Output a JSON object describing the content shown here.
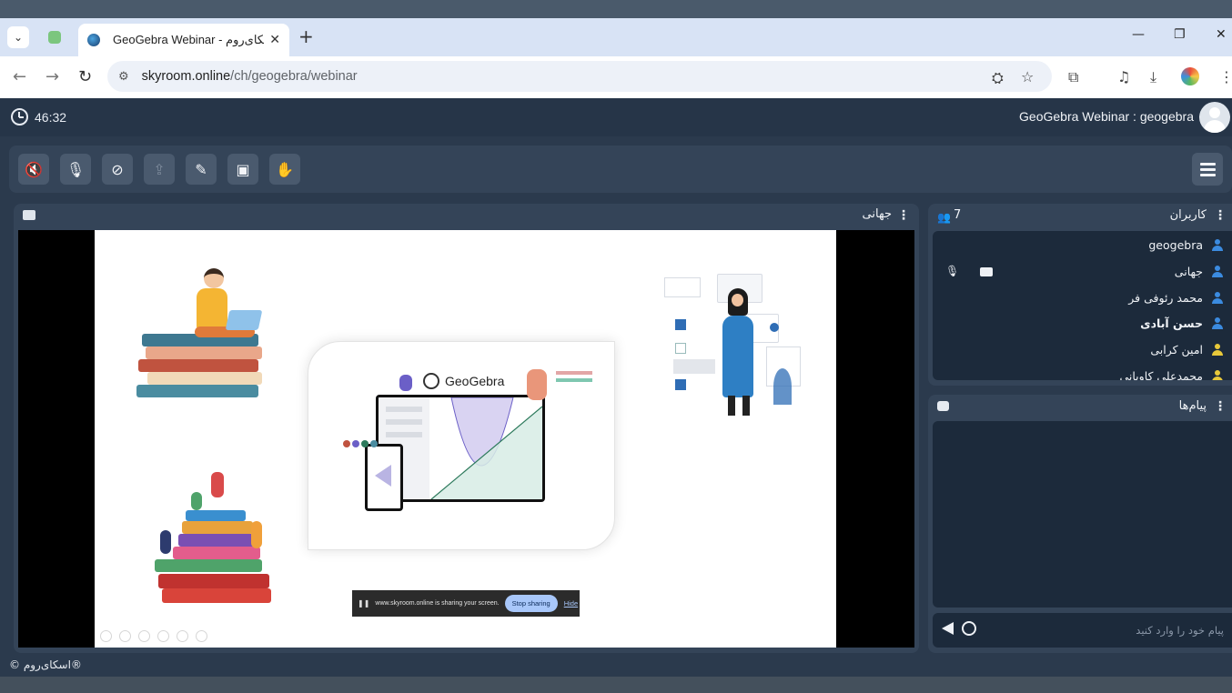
{
  "browser": {
    "tab_title": "GeoGebra Webinar - اسکای‌روم",
    "url_host": "skyroom.online",
    "url_path": "/ch/geogebra/webinar"
  },
  "header": {
    "timer": "46:32",
    "room_title": "GeoGebra Webinar : geogebra"
  },
  "share_panel": {
    "title": "جهانی"
  },
  "slide": {
    "logo_text": "GeoGebra",
    "share_banner_text": "www.skyroom.online is sharing your screen.",
    "stop_sharing_label": "Stop sharing",
    "hide_label": "Hide"
  },
  "users": {
    "title": "کاربران",
    "count": "7",
    "items": [
      {
        "name": "geogebra",
        "color": "#3b8be0"
      },
      {
        "name": "جهانی",
        "color": "#3b8be0"
      },
      {
        "name": "محمد رئوفی فر",
        "color": "#3b8be0"
      },
      {
        "name": "حسن آبادی",
        "color": "#3b8be0"
      },
      {
        "name": "امین کرابی",
        "color": "#e8c93a"
      },
      {
        "name": "محمدعلی کاوبانی",
        "color": "#e8c93a"
      }
    ]
  },
  "messages": {
    "title": "پیام‌ها",
    "input_placeholder": "پیام خود را وارد کنید"
  },
  "footer": {
    "copyright": "© اسکای‌روم®"
  },
  "colors": {
    "app_bg": "#2b3a4d",
    "panel_bg": "#344458",
    "list_bg": "#1c2a3b"
  }
}
